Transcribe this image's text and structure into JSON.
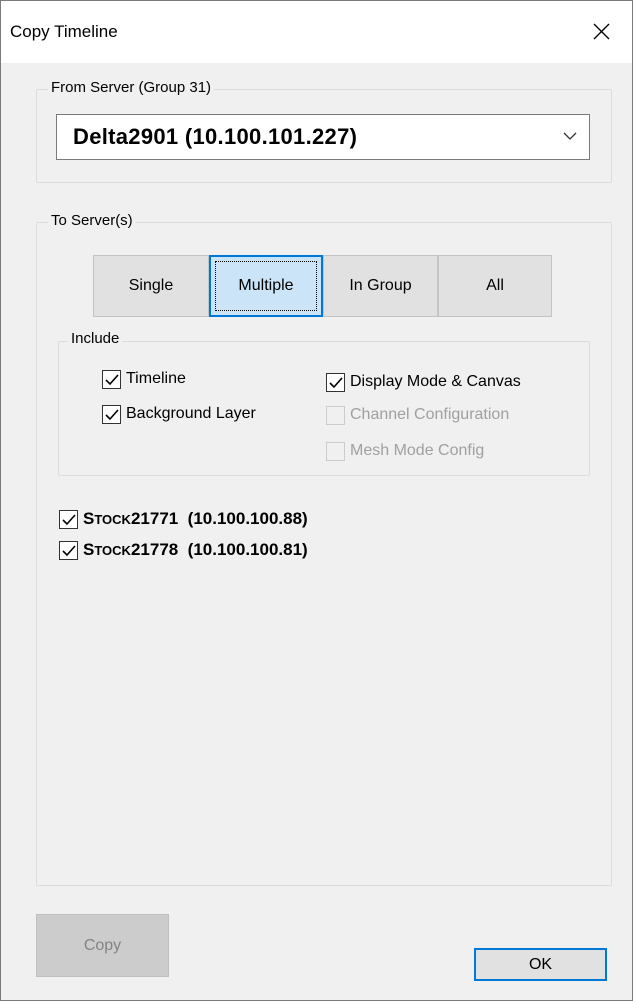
{
  "window": {
    "title": "Copy Timeline",
    "close_icon": "close-icon"
  },
  "from_server": {
    "group_label": "From Server  (Group 31)",
    "selected_value": "Delta2901  (10.100.101.227)"
  },
  "to_servers": {
    "group_label": "To Server(s)",
    "mode_buttons": [
      {
        "label": "Single",
        "selected": false
      },
      {
        "label": "Multiple",
        "selected": true
      },
      {
        "label": "In Group",
        "selected": false
      },
      {
        "label": "All",
        "selected": false
      }
    ],
    "include": {
      "group_label": "Include",
      "options": [
        {
          "label": "Timeline",
          "checked": true,
          "enabled": true
        },
        {
          "label": "Background Layer",
          "checked": true,
          "enabled": true
        },
        {
          "label": "Display Mode & Canvas",
          "checked": true,
          "enabled": true
        },
        {
          "label": "Channel Configuration",
          "checked": false,
          "enabled": false
        },
        {
          "label": "Mesh Mode Config",
          "checked": false,
          "enabled": false
        }
      ]
    },
    "servers": [
      {
        "name_lead": "S",
        "name_small": "TOCK",
        "name_rest": "21771",
        "address": "  (10.100.100.88)",
        "checked": true
      },
      {
        "name_lead": "S",
        "name_small": "TOCK",
        "name_rest": "21778",
        "address": "  (10.100.100.81)",
        "checked": true
      }
    ]
  },
  "footer": {
    "copy_label": "Copy",
    "ok_label": "OK"
  }
}
